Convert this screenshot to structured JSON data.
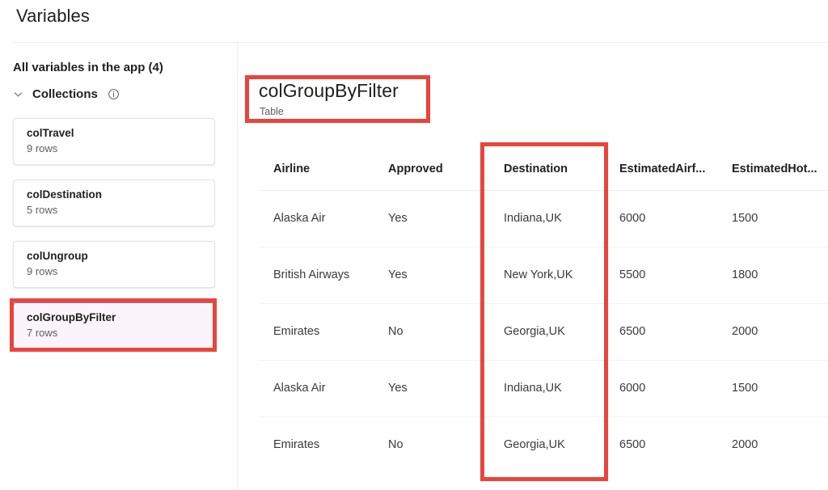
{
  "page": {
    "title": "Variables"
  },
  "sidebar": {
    "heading": "All variables in the app (4)",
    "group": {
      "label": "Collections",
      "chevron_icon": "chevron-down-icon",
      "info_icon": "info-circle-icon"
    },
    "items": [
      {
        "name": "colTravel",
        "rows": "9 rows",
        "selected": false
      },
      {
        "name": "colDestination",
        "rows": "5 rows",
        "selected": false
      },
      {
        "name": "colUngroup",
        "rows": "9 rows",
        "selected": false
      },
      {
        "name": "colGroupByFilter",
        "rows": "7 rows",
        "selected": true
      }
    ]
  },
  "detail": {
    "title": "colGroupByFilter",
    "subtitle": "Table",
    "table": {
      "columns": [
        "Airline",
        "Approved",
        "Destination",
        "EstimatedAirf...",
        "EstimatedHot..."
      ],
      "rows": [
        [
          "Alaska Air",
          "Yes",
          "Indiana,UK",
          "6000",
          "1500"
        ],
        [
          "British Airways",
          "Yes",
          "New York,UK",
          "5500",
          "1800"
        ],
        [
          "Emirates",
          "No",
          "Georgia,UK",
          "6500",
          "2000"
        ],
        [
          "Alaska Air",
          "Yes",
          "Indiana,UK",
          "6000",
          "1500"
        ],
        [
          "Emirates",
          "No",
          "Georgia,UK",
          "6500",
          "2000"
        ]
      ]
    }
  },
  "annotations": {
    "color": "#e8453c",
    "boxes": [
      {
        "name": "title-highlight",
        "target": "colGroupByFilter"
      },
      {
        "name": "destination-column-highlight",
        "target": "Destination"
      },
      {
        "name": "selected-collection-highlight",
        "target": "colGroupByFilter"
      }
    ]
  },
  "colors": {
    "accent": "#e8453c",
    "selected_card_bg": "#fbf4fb",
    "selected_card_border": "#8a7d9c",
    "text_primary": "#201f1e",
    "text_secondary": "#605e5c",
    "divider": "#edebe9"
  }
}
